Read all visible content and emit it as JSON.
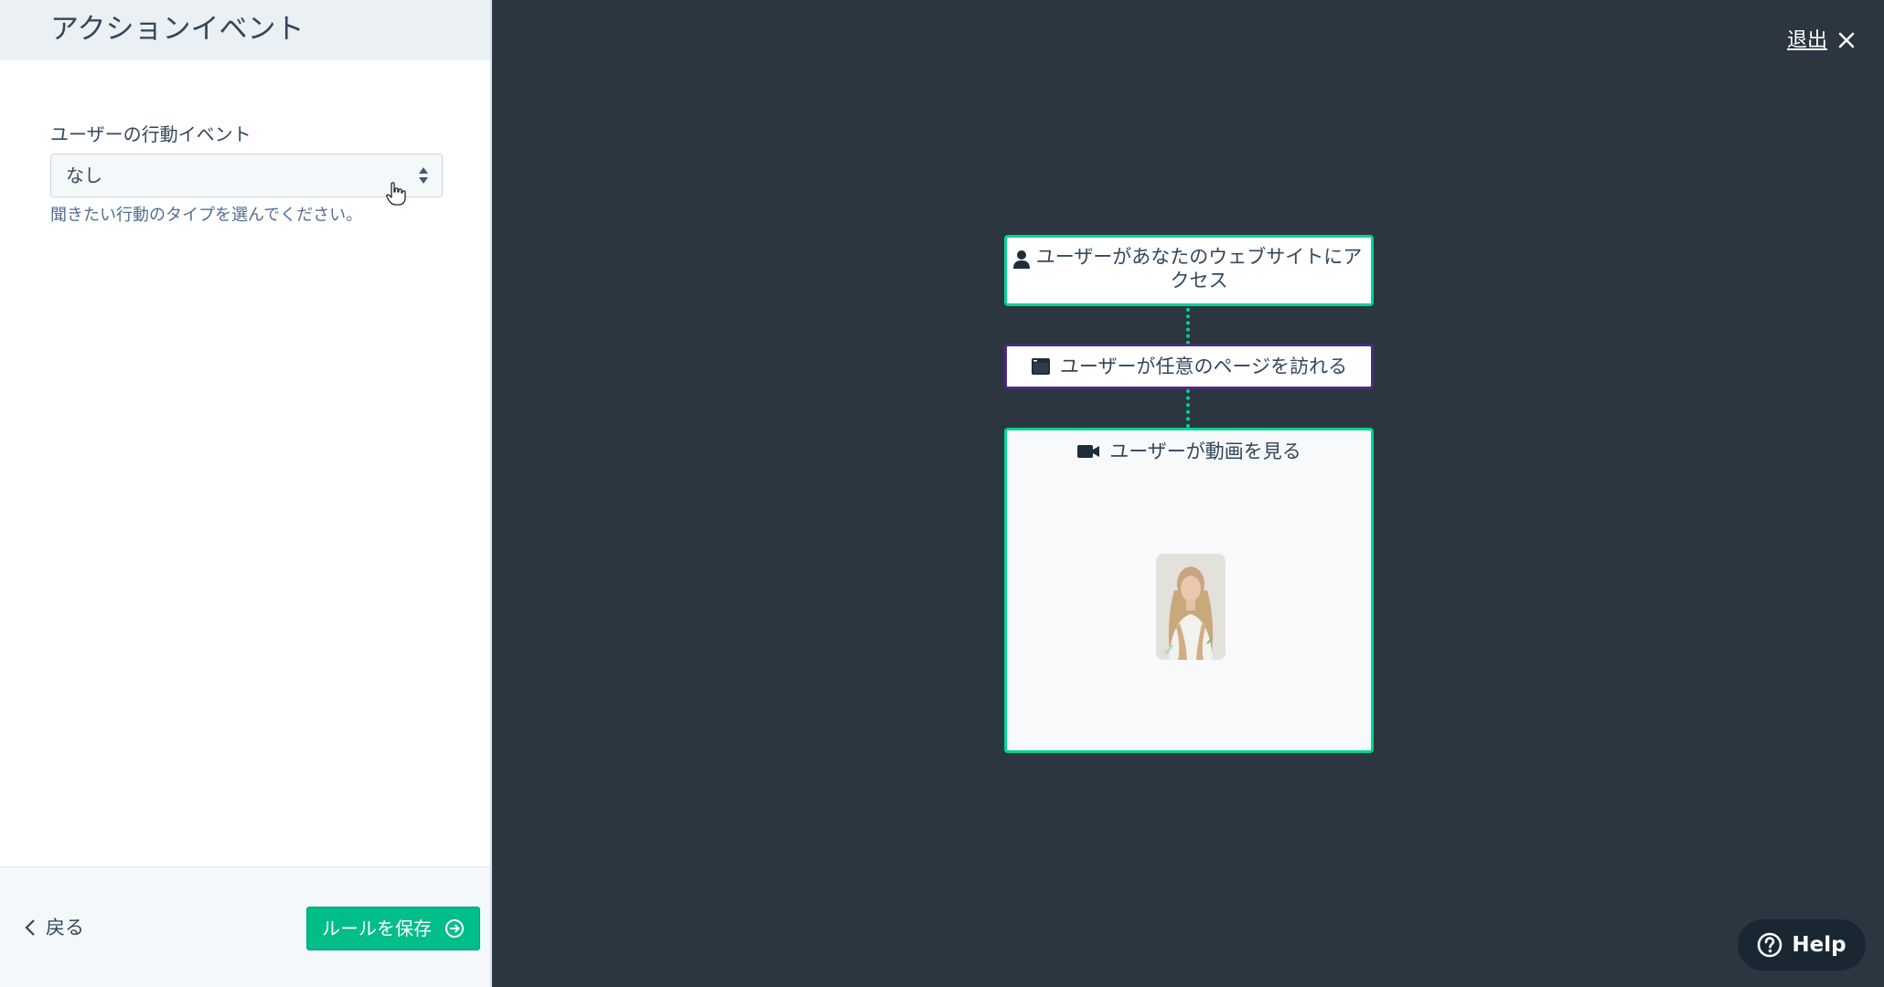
{
  "panel": {
    "title": "アクションイベント",
    "field_label": "ユーザーの行動イベント",
    "select_value": "なし",
    "help_text": "聞きたい行動のタイプを選んでください。",
    "back_label": "戻る",
    "save_label": "ルールを保存"
  },
  "exit": {
    "label": "退出",
    "close_icon": "close-icon"
  },
  "flow": {
    "steps": [
      {
        "label": "ユーザーがあなたのウェブサイトにアクセス",
        "icon": "user-icon"
      },
      {
        "label": "ユーザーが任意のページを訪れる",
        "icon": "browser-window-icon"
      },
      {
        "label": "ユーザーが動画を見る",
        "icon": "video-camera-icon"
      }
    ],
    "connector_color": "#00d492",
    "card_border_color": "#00d492",
    "selected_border_color": "#4b2c80"
  },
  "help": {
    "label": "Help",
    "icon": "question-circle-icon"
  },
  "colors": {
    "canvas_background": "#2b3640",
    "save_button": "#00bd8a",
    "text": "#33475b"
  }
}
